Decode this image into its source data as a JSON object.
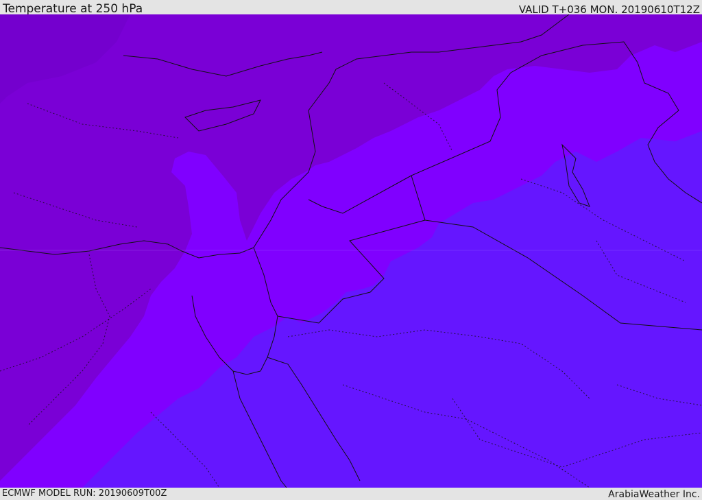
{
  "header": {
    "title": "Temperature at 250 hPa",
    "valid": "VALID T+036 MON. 20190610T12Z"
  },
  "footer": {
    "model_run": "ECMWF MODEL RUN: 20190609T00Z",
    "credit": "ArabiaWeather Inc."
  },
  "map": {
    "field": "temperature",
    "colors": {
      "coldest_band": "#7a00d6",
      "middle_band": "#8000ff",
      "warmer_band": "#6516ff",
      "land_borders": "#111111"
    }
  }
}
